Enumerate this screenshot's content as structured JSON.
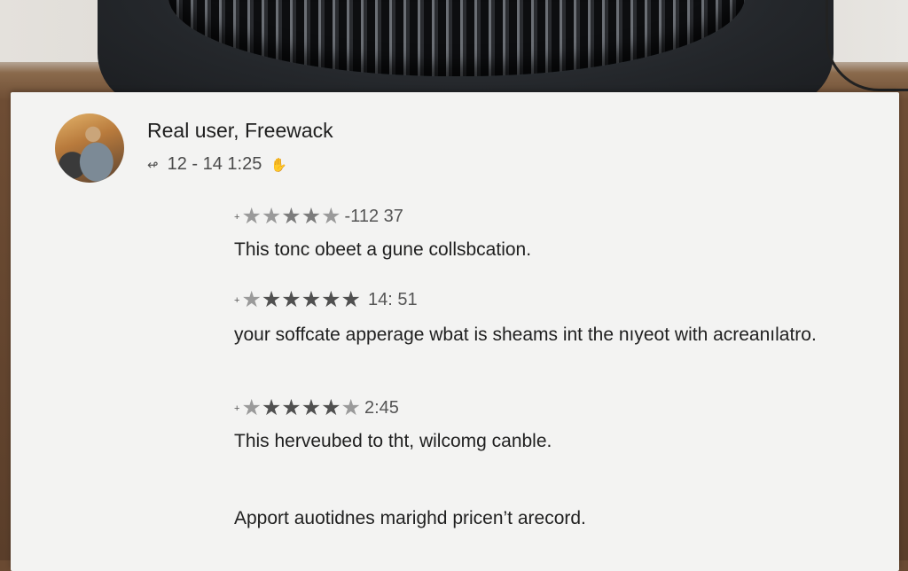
{
  "post": {
    "user_name": "Real user, Freewack",
    "timestamp": "12 - 14 1:25",
    "back_icon": "reply-arrow-icon",
    "flag_icon": "hand-icon"
  },
  "reviews": [
    {
      "rating_stars": [
        "grey",
        "grey",
        "mid",
        "mid",
        "grey"
      ],
      "rating_time": "-112 37",
      "text": "This tonc obeet a gune collsbcation."
    },
    {
      "rating_stars": [
        "grey",
        "dark",
        "dark",
        "dark",
        "dark",
        "dark"
      ],
      "rating_time": "14: 51",
      "text": "your soffcate apperage wbat is sheams int the nıyeot with acreanılatro."
    },
    {
      "rating_stars": [
        "grey",
        "dark",
        "dark",
        "dark",
        "dark",
        "grey"
      ],
      "rating_time": "2:45",
      "text": "This herveubed to tht, wilcomg canble."
    }
  ],
  "footer_text": "Apport auotidnes marighd pricen’t arecord.",
  "colors": {
    "card_bg": "#f3f3f2",
    "text": "#1f1f1f",
    "star_dark": "#505050",
    "star_grey": "#9a9a9a"
  }
}
